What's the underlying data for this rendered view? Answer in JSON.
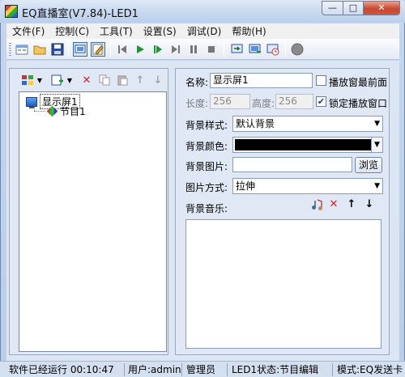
{
  "window": {
    "title": "EQ直播室(V7.84)-LED1",
    "minimize_glyph": "—",
    "maximize_glyph": "□",
    "close_glyph": "✕"
  },
  "menu": [
    "文件(F)",
    "控制(C)",
    "工具(T)",
    "设置(S)",
    "调试(D)",
    "帮助(H)"
  ],
  "toolbar_icons": [
    "new-icon",
    "open-folder-icon",
    "save-icon",
    "screen-icon",
    "edit-icon",
    "first-icon",
    "play-icon",
    "step-icon",
    "next-icon",
    "pause-icon",
    "stop-icon",
    "send-icon",
    "screen-send-icon",
    "screen-timer-icon",
    "record-icon"
  ],
  "tree": {
    "root": "显示屏1",
    "child": "节目1"
  },
  "props": {
    "name_label": "名称:",
    "name_value": "显示屏1",
    "topmost_label": "播放窗最前面",
    "topmost_checked": false,
    "width_label": "长度:",
    "width_value": "256",
    "height_label": "高度:",
    "height_value": "256",
    "lock_label": "锁定播放窗口",
    "lock_checked": true,
    "bg_style_label": "背景样式:",
    "bg_style_value": "默认背景",
    "bg_color_label": "背景颜色:",
    "bg_color_value": "#000000",
    "bg_image_label": "背景图片:",
    "bg_image_value": "",
    "browse_label": "浏览",
    "image_mode_label": "图片方式:",
    "image_mode_value": "拉伸",
    "bg_music_label": "背景音乐:"
  },
  "status": {
    "uptime": "软件已经运行 00:10:47",
    "user": "用户:admin",
    "role": "管理员",
    "led_state": "LED1状态:节目编辑",
    "mode": "模式:EQ发送卡"
  },
  "colors": {
    "accent": "#3b6eb0",
    "panel_bg": "#dfe8f4",
    "close_red": "#c8462f"
  }
}
